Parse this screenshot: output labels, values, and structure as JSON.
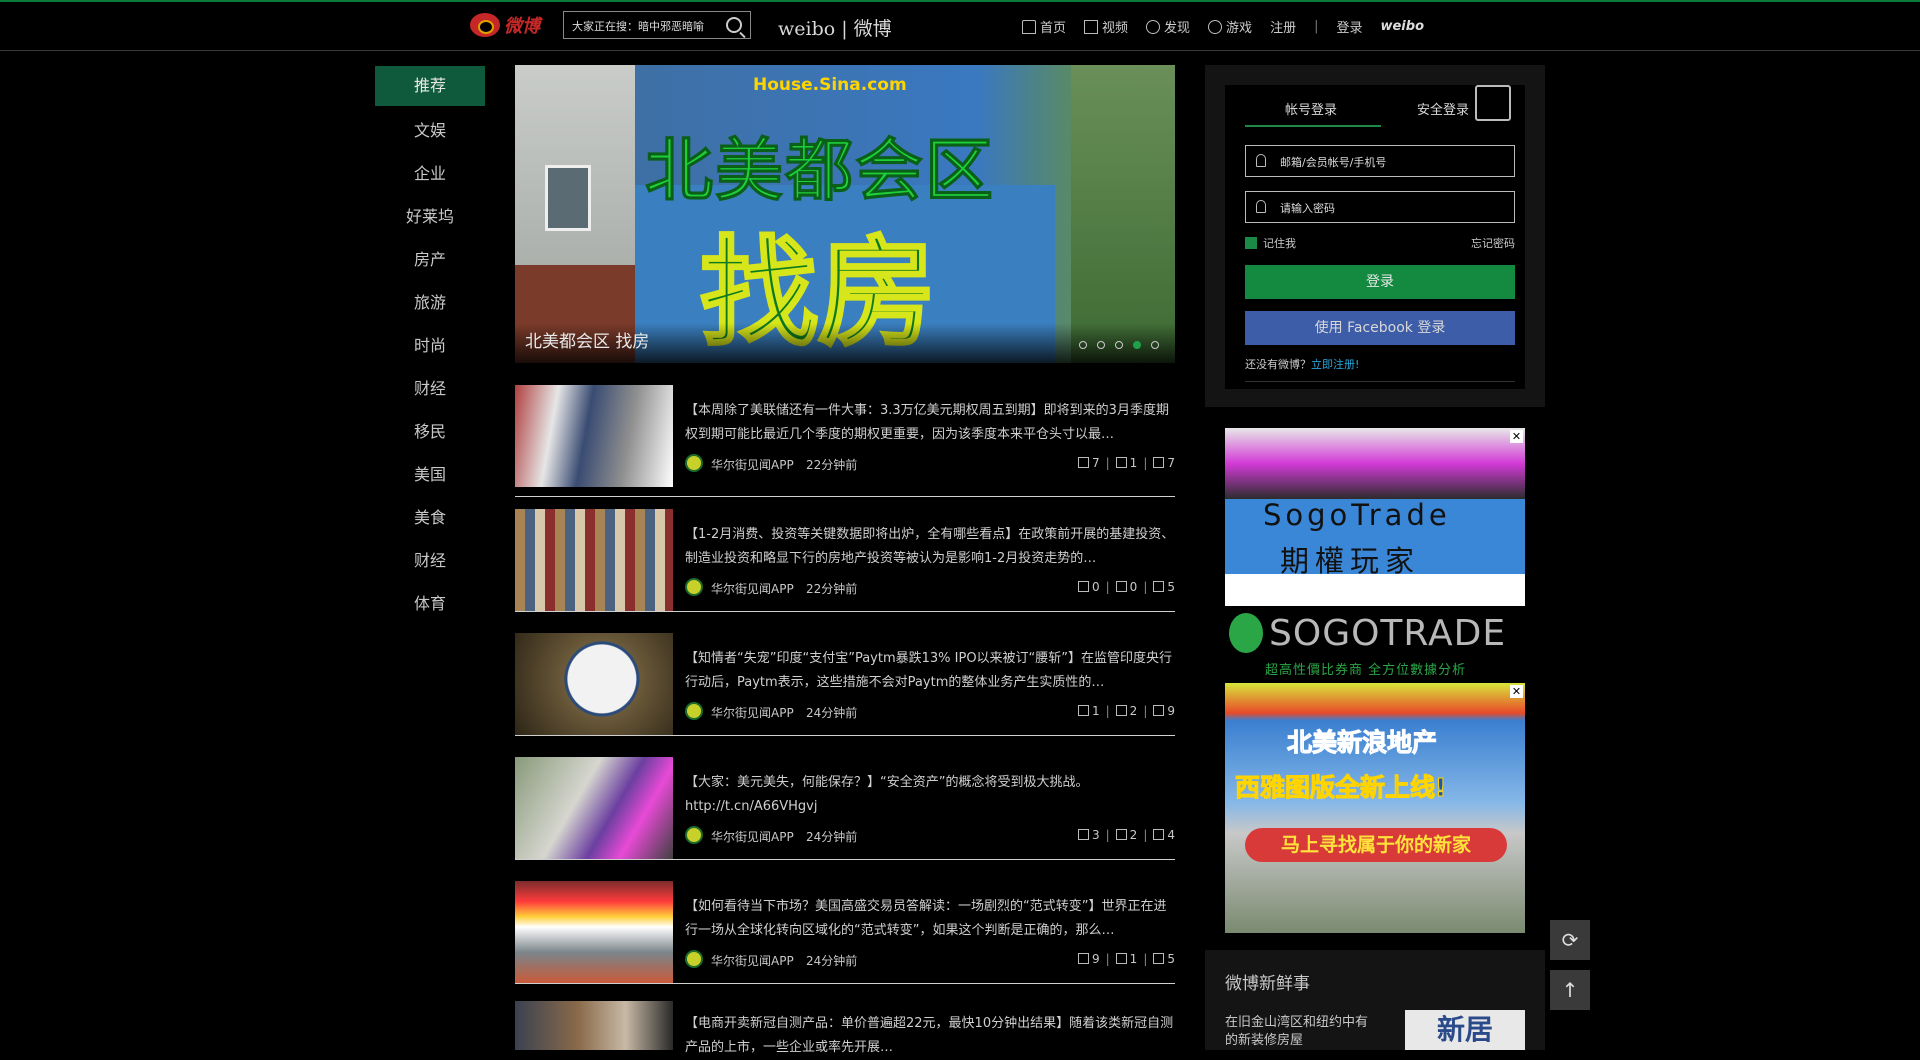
{
  "header": {
    "logo_text": "微博",
    "search_placeholder": "大家正在搜：暗中邪恶暗喻",
    "brand": "weibo | 微博",
    "nav": [
      {
        "label": "首页",
        "icon": "home-icon"
      },
      {
        "label": "视频",
        "icon": "video-icon"
      },
      {
        "label": "发现",
        "icon": "discover-icon"
      },
      {
        "label": "游戏",
        "icon": "game-icon"
      }
    ],
    "register": "注册",
    "separator": "|",
    "login": "登录",
    "weibo_mark": "weibo"
  },
  "sidebar": {
    "items": [
      "推荐",
      "文娱",
      "企业",
      "好莱坞",
      "房产",
      "旅游",
      "时尚",
      "财经",
      "移民",
      "美国",
      "美食",
      "财经",
      "体育"
    ]
  },
  "carousel": {
    "source": "House.Sina.com",
    "headline": "北美都会区",
    "big_word": "找房",
    "caption": "北美都会区 找房",
    "slides": 5,
    "active_slide": 4
  },
  "feed": [
    {
      "title": "【本周除了美联储还有一件大事：3.3万亿美元期权周五到期】即将到来的3月季度期权到期可能比最近几个季度的期权更重要，因为该季度本来平仓头寸以最…",
      "source": "华尔街见闻APP",
      "time": "22分钟前",
      "reposts": "7",
      "comments": "1",
      "likes": "7"
    },
    {
      "title": "【1-2月消费、投资等关键数据即将出炉，全有哪些看点】在政策前开展的基建投资、制造业投资和略显下行的房地产投资等被认为是影响1-2月投资走势的…",
      "source": "华尔街见闻APP",
      "time": "22分钟前",
      "reposts": "0",
      "comments": "0",
      "likes": "5"
    },
    {
      "title": "【知情者“失宠”印度“支付宝”Paytm暴跌13% IPO以来被订“腰斩”】在监管印度央行行动后，Paytm表示，这些措施不会对Paytm的整体业务产生实质性的…",
      "source": "华尔街见闻APP",
      "time": "24分钟前",
      "reposts": "1",
      "comments": "2",
      "likes": "9"
    },
    {
      "title": "【大家：美元美失，何能保存？】“安全资产”的概念将受到极大挑战。 http://t.cn/A66VHgvj",
      "source": "华尔街见闻APP",
      "time": "24分钟前",
      "reposts": "3",
      "comments": "2",
      "likes": "4"
    },
    {
      "title": "【如何看待当下市场？美国高盛交易员答解读：一场剧烈的“范式转变”】世界正在进行一场从全球化转向区域化的“范式转变”，如果这个判断是正确的，那么…",
      "source": "华尔街见闻APP",
      "time": "24分钟前",
      "reposts": "9",
      "comments": "1",
      "likes": "5"
    }
  ],
  "feed_partial_title": "【电商开卖新冠自测产品：单价普遍超22元，最快10分钟出结果】随着该类新冠自测产品的上市，一些企业或率先开展…",
  "login": {
    "tab_account": "帐号登录",
    "tab_secure": "安全登录",
    "username_placeholder": "邮箱/会员帐号/手机号",
    "password_placeholder": "请输入密码",
    "remember": "记住我",
    "forgot": "忘记密码",
    "login_button": "登录",
    "facebook_button": "使用 Facebook 登录",
    "no_account": "还没有微博？",
    "register_link": "立即注册!"
  },
  "ads": {
    "close": "✕",
    "sogo_line1": "SogoTrade",
    "sogo_line2": "期權玩家",
    "sogo_brand": "SOGOTRADE",
    "sogo_slogan": "超高性價比券商 全方位數據分析",
    "realty_line1": "北美新浪地产",
    "realty_line2": "西雅图版全新上线!",
    "realty_button": "马上寻找属于你的新家"
  },
  "hot": {
    "heading": "微博新鲜事",
    "text": "在旧金山湾区和纽约中有的新装修房屋",
    "image_text": "新居"
  },
  "tools": {
    "refresh": "⟳",
    "top": "↑"
  }
}
